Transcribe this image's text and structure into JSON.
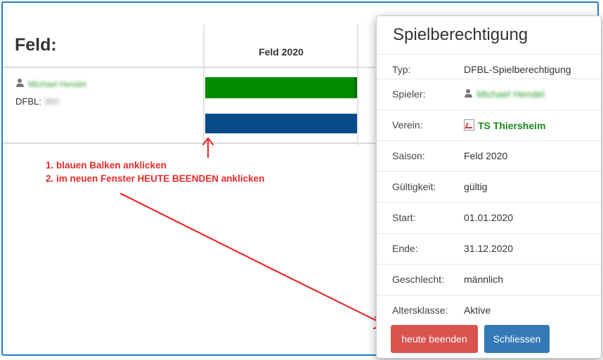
{
  "page": {
    "title": "Feld:",
    "column_header": "Feld 2020"
  },
  "player": {
    "name": "Michael Hendel",
    "dfbl_label": "DFBL:",
    "dfbl_value": "360"
  },
  "annotations": {
    "line1": "1. blauen Balken anklicken",
    "line2": "2. im neuen Fenster HEUTE BEENDEN anklicken"
  },
  "modal": {
    "title": "Spielberechtigung",
    "rows": [
      {
        "label": "Typ:",
        "value": "DFBL-Spielberechtigung"
      },
      {
        "label": "Spieler:",
        "value": "Michael Hendel"
      },
      {
        "label": "Verein:",
        "value": "TS Thiersheim"
      },
      {
        "label": "Saison:",
        "value": "Feld 2020"
      },
      {
        "label": "Gültigkeit:",
        "value": "gültig"
      },
      {
        "label": "Start:",
        "value": "01.01.2020"
      },
      {
        "label": "Ende:",
        "value": "31.12.2020"
      },
      {
        "label": "Geschlecht:",
        "value": "männlich"
      },
      {
        "label": "Altersklasse:",
        "value": "Aktive"
      }
    ],
    "buttons": {
      "end_today": "heute beenden",
      "close": "Schliessen"
    }
  },
  "colors": {
    "frame": "#1f7ec8",
    "bar_green": "#008a00",
    "bar_blue": "#064a8a",
    "annotation": "#e52a2a",
    "btn_danger": "#d9534f",
    "btn_primary": "#337ab7"
  },
  "icons": [
    "person-icon",
    "club-logo-icon"
  ]
}
